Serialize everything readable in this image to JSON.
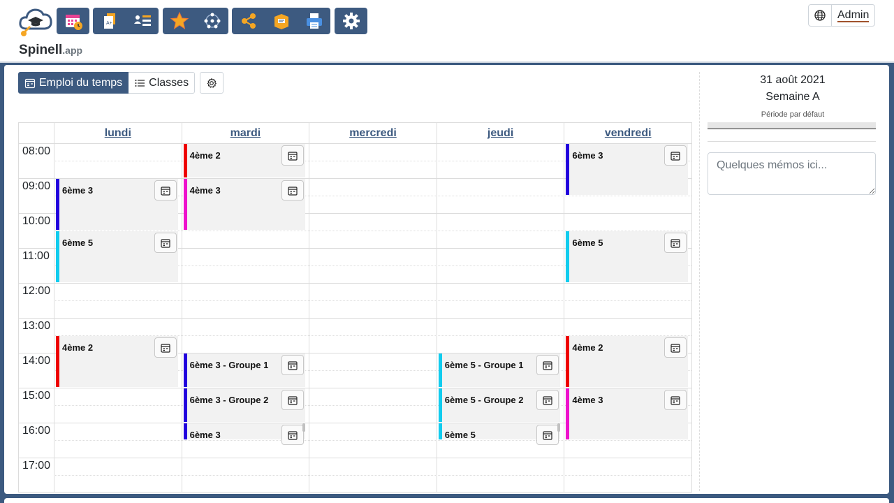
{
  "brand": {
    "name": "Spinell",
    "suffix": ".app"
  },
  "toolbar": {
    "groups": [
      [
        "calendar-clock-icon"
      ],
      [
        "document-grades-icon",
        "students-list-icon"
      ],
      [
        "star-icon",
        "network-people-icon"
      ],
      [
        "share-icon",
        "package-icon",
        "printer-icon"
      ],
      [
        "gear-icon"
      ]
    ]
  },
  "user": {
    "name": "Admin"
  },
  "tabs": {
    "schedule": "Emploi du temps",
    "classes": "Classes"
  },
  "calendar": {
    "days": [
      "lundi",
      "mardi",
      "mercredi",
      "jeudi",
      "vendredi"
    ],
    "hours": [
      "08:00",
      "09:00",
      "10:00",
      "11:00",
      "12:00",
      "13:00",
      "14:00",
      "15:00",
      "16:00",
      "17:00"
    ],
    "events": [
      {
        "day": 0,
        "start": "09:00",
        "end": "10:30",
        "label": "6ème 3",
        "color": "#2200dd"
      },
      {
        "day": 0,
        "start": "10:30",
        "end": "12:00",
        "label": "6ème 5",
        "color": "#11ccee"
      },
      {
        "day": 0,
        "start": "13:30",
        "end": "15:00",
        "label": "4ème 2",
        "color": "#ee0000"
      },
      {
        "day": 1,
        "start": "08:00",
        "end": "09:00",
        "label": "4ème 2",
        "color": "#ee0000"
      },
      {
        "day": 1,
        "start": "09:00",
        "end": "10:30",
        "label": "4ème 3",
        "color": "#ee11cc"
      },
      {
        "day": 1,
        "start": "14:00",
        "end": "15:00",
        "label": "6ème 3 - Groupe 1",
        "color": "#2200dd"
      },
      {
        "day": 1,
        "start": "15:00",
        "end": "16:00",
        "label": "6ème 3 - Groupe 2",
        "color": "#2200dd"
      },
      {
        "day": 1,
        "start": "16:00",
        "end": "16:30",
        "label": "6ème 3",
        "color": "#2200dd"
      },
      {
        "day": 3,
        "start": "14:00",
        "end": "15:00",
        "label": "6ème 5 - Groupe 1",
        "color": "#11ccee"
      },
      {
        "day": 3,
        "start": "15:00",
        "end": "16:00",
        "label": "6ème 5 - Groupe 2",
        "color": "#11ccee"
      },
      {
        "day": 3,
        "start": "16:00",
        "end": "16:30",
        "label": "6ème 5",
        "color": "#11ccee"
      },
      {
        "day": 4,
        "start": "08:00",
        "end": "09:30",
        "label": "6ème 3",
        "color": "#2200dd"
      },
      {
        "day": 4,
        "start": "10:30",
        "end": "12:00",
        "label": "6ème 5",
        "color": "#11ccee"
      },
      {
        "day": 4,
        "start": "13:30",
        "end": "15:00",
        "label": "4ème 2",
        "color": "#ee0000"
      },
      {
        "day": 4,
        "start": "15:00",
        "end": "16:30",
        "label": "4ème 3",
        "color": "#ee11cc"
      }
    ]
  },
  "sidebar": {
    "date": "31 août 2021",
    "week": "Semaine A",
    "period": "Période par défaut",
    "memo_placeholder": "Quelques mémos ici..."
  }
}
